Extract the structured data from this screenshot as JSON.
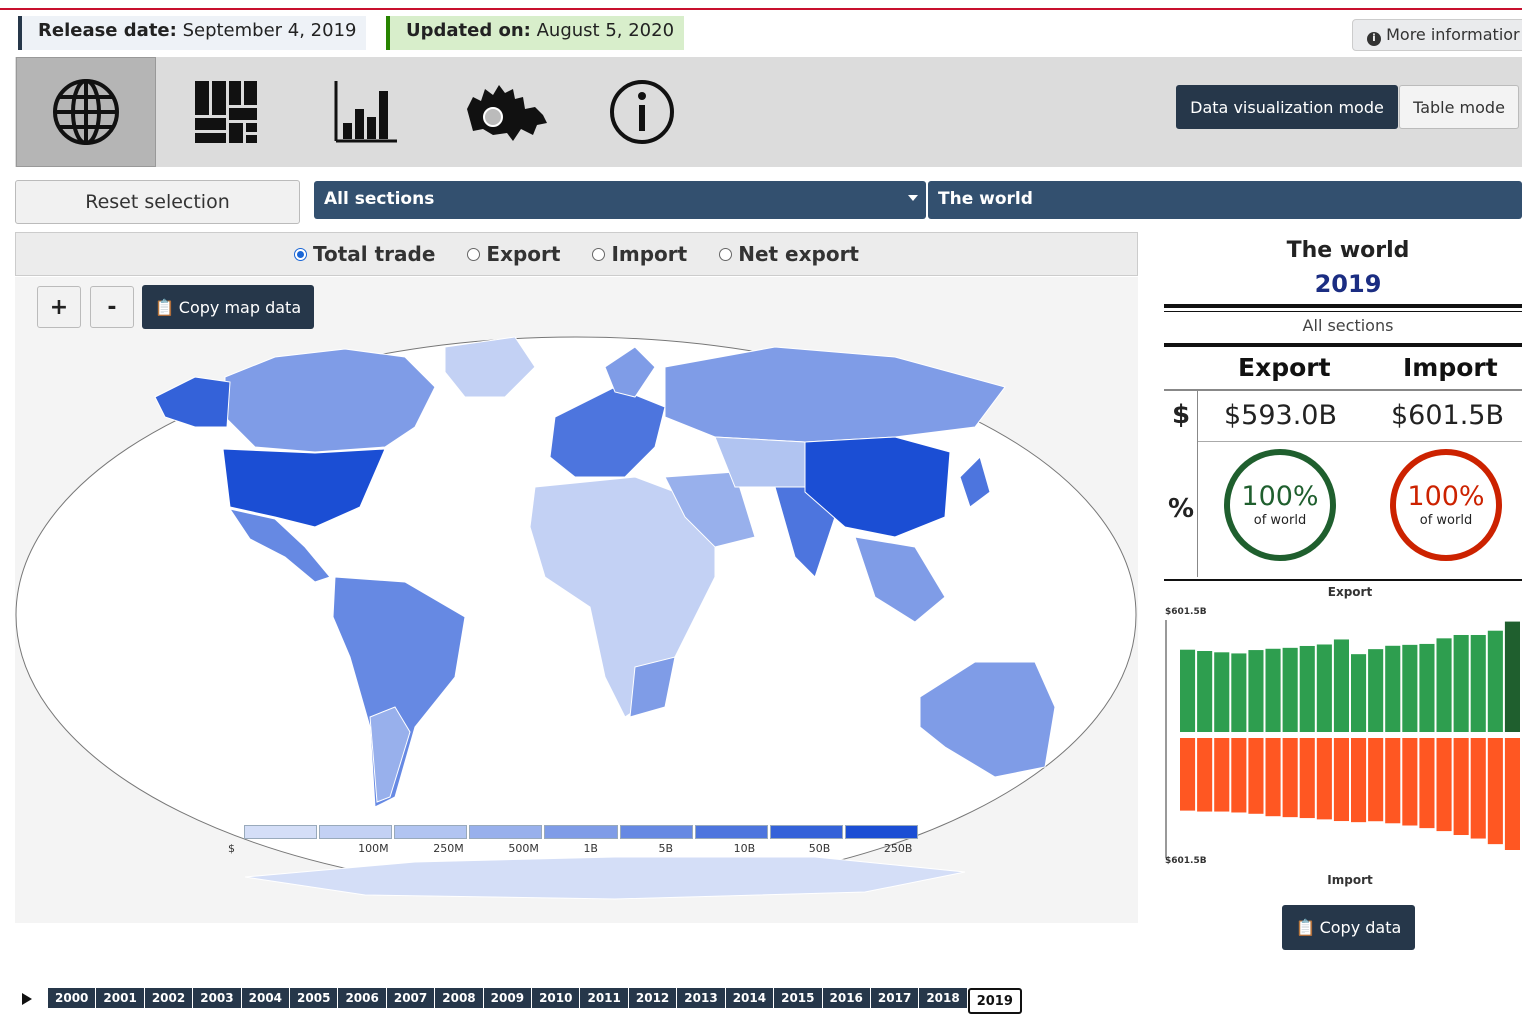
{
  "header": {
    "release_label": "Release date:",
    "release_value": "September 4, 2019",
    "updated_label": "Updated on:",
    "updated_value": "August 5, 2020",
    "more_info": "More informatior"
  },
  "toolbar": {
    "tools": [
      "globe-icon",
      "treemap-icon",
      "bar-chart-icon",
      "canada-map-icon",
      "info-icon"
    ],
    "mode_dataviz": "Data visualization mode",
    "mode_table": "Table mode"
  },
  "filters": {
    "reset": "Reset selection",
    "section": "All sections",
    "region": "The world"
  },
  "trade_types": {
    "total": "Total trade",
    "export": "Export",
    "import": "Import",
    "net": "Net export",
    "selected": "total"
  },
  "map": {
    "zoom_in": "+",
    "zoom_out": "-",
    "copy": "Copy map data",
    "legend": {
      "colors": [
        "#d4def7",
        "#c3d1f4",
        "#b1c4f1",
        "#98b0ec",
        "#7f9ce7",
        "#6689e3",
        "#4d75de",
        "#3462d9",
        "#1b4ed4"
      ],
      "labels": [
        "$",
        "100M",
        "250M",
        "500M",
        "1B",
        "5B",
        "10B",
        "50B",
        "250B"
      ]
    }
  },
  "summary": {
    "title": "The world",
    "year": "2019",
    "section": "All sections",
    "export_label": "Export",
    "import_label": "Import",
    "dollar_symbol": "$",
    "percent_symbol": "%",
    "export_value": "$593.0B",
    "import_value": "$601.5B",
    "export_pct": "100%",
    "import_pct": "100%",
    "pct_sub": "of world",
    "export_color": "#1f5f2e",
    "import_color": "#cc2200",
    "copy": "Copy data"
  },
  "chart_data": {
    "type": "bar",
    "top_label": "Export",
    "bottom_label": "Import",
    "tick_top": "$601.5B",
    "tick_bottom": "$601.5B",
    "export_color": "#2e9e4f",
    "export_selected_color": "#1f5f2e",
    "import_color": "#ff5722",
    "ylim": [
      0,
      601.5
    ],
    "years": [
      "2000",
      "2001",
      "2002",
      "2003",
      "2004",
      "2005",
      "2006",
      "2007",
      "2008",
      "2009",
      "2010",
      "2011",
      "2012",
      "2013",
      "2014",
      "2015",
      "2016",
      "2017",
      "2018",
      "2019"
    ],
    "export": [
      442,
      435,
      428,
      422,
      440,
      447,
      452,
      462,
      470,
      497,
      418,
      445,
      463,
      468,
      473,
      503,
      521,
      521,
      544,
      593
    ],
    "import": [
      390,
      395,
      395,
      400,
      407,
      420,
      425,
      430,
      437,
      446,
      452,
      447,
      458,
      470,
      484,
      500,
      521,
      540,
      570,
      601.5
    ]
  },
  "timeline": {
    "years": [
      "2000",
      "2001",
      "2002",
      "2003",
      "2004",
      "2005",
      "2006",
      "2007",
      "2008",
      "2009",
      "2010",
      "2011",
      "2012",
      "2013",
      "2014",
      "2015",
      "2016",
      "2017",
      "2018",
      "2019"
    ],
    "selected": "2019"
  }
}
